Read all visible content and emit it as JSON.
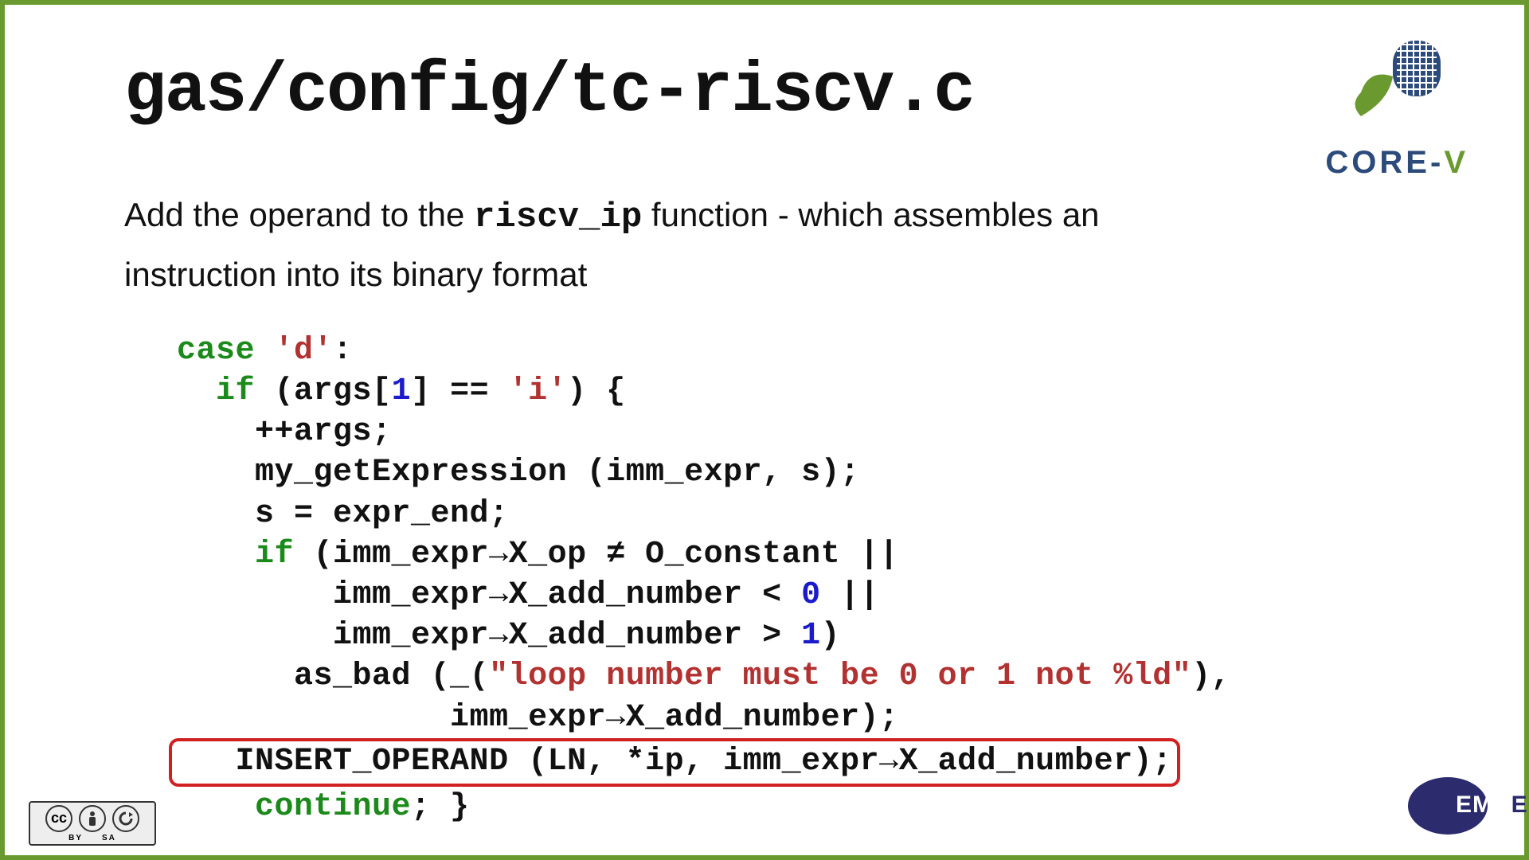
{
  "title": "gas/config/tc-riscv.c",
  "desc_pre": "Add the operand to the ",
  "desc_code": "riscv_ip",
  "desc_post": " function - which assembles an instruction into its binary format",
  "code": {
    "l1a": "case",
    "l1b": " ",
    "l1c": "'d'",
    "l1d": ":",
    "l2a": "  ",
    "l2b": "if",
    "l2c": " (args[",
    "l2d": "1",
    "l2e": "] == ",
    "l2f": "'i'",
    "l2g": ") {",
    "l3": "    ++args;",
    "l4": "    my_getExpression (imm_expr, s);",
    "l5": "    s = expr_end;",
    "l6a": "    ",
    "l6b": "if",
    "l6c": " (imm_expr→X_op ≠ O_constant ||",
    "l7": "        imm_expr→X_add_number < ",
    "l7n": "0",
    "l7e": " ||",
    "l8": "        imm_expr→X_add_number > ",
    "l8n": "1",
    "l8e": ")",
    "l9": "      as_bad (_(",
    "l9s": "\"loop number must be 0 or 1 not %ld\"",
    "l9e": "),",
    "l10": "              imm_expr→X_add_number);",
    "l11": "   INSERT_OPERAND (LN, *ip, imm_expr→X_add_number);",
    "l12a": "    ",
    "l12b": "continue",
    "l12c": "; }"
  },
  "logos": {
    "corev": "CORE-V",
    "corev_pre": "CORE-",
    "corev_v": "V",
    "embecosm": "EMBECOSM",
    "cc_labels": {
      "cc": "cc",
      "by": "BY",
      "sa": "SA"
    }
  }
}
